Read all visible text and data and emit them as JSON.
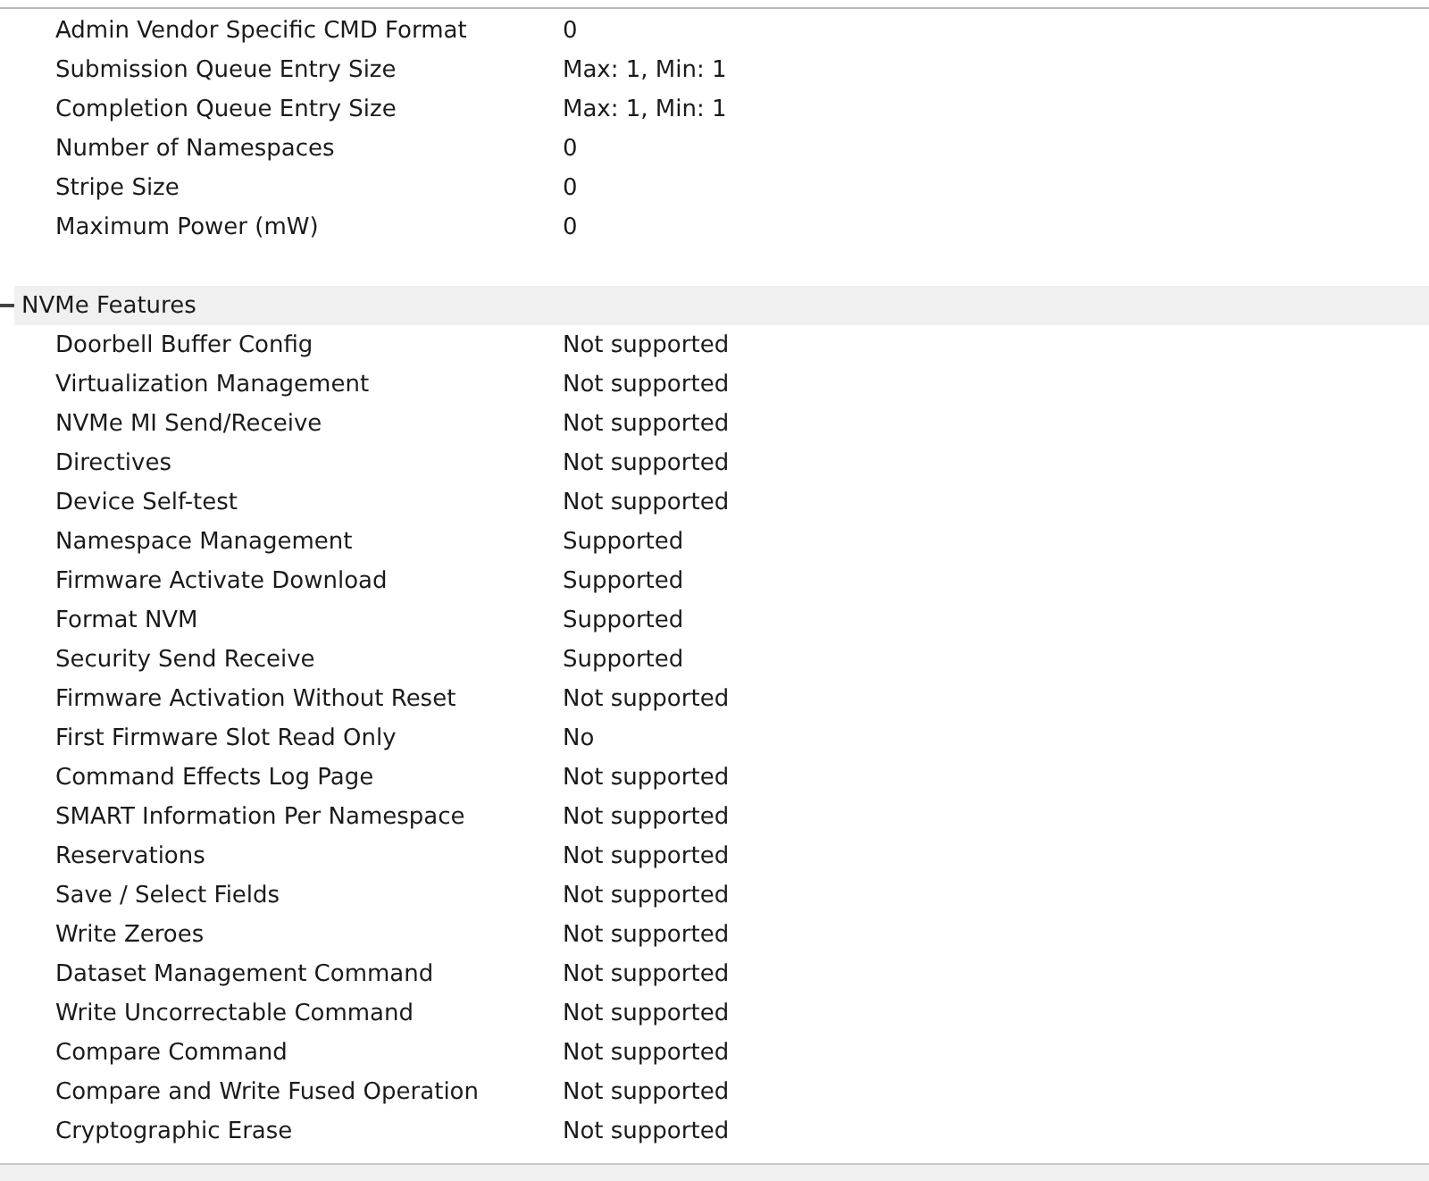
{
  "groups": [
    {
      "properties": [
        {
          "name": "Admin Vendor Specific CMD Format",
          "value": "0"
        },
        {
          "name": "Submission Queue Entry Size",
          "value": "Max: 1, Min: 1"
        },
        {
          "name": "Completion Queue Entry Size",
          "value": "Max: 1, Min: 1"
        },
        {
          "name": "Number of Namespaces",
          "value": "0"
        },
        {
          "name": "Stripe Size",
          "value": "0"
        },
        {
          "name": "Maximum Power (mW)",
          "value": "0"
        }
      ]
    },
    {
      "title": "NVMe Features",
      "expanded": true,
      "properties": [
        {
          "name": "Doorbell Buffer Config",
          "value": "Not supported"
        },
        {
          "name": "Virtualization Management",
          "value": "Not supported"
        },
        {
          "name": "NVMe MI Send/Receive",
          "value": "Not supported"
        },
        {
          "name": "Directives",
          "value": "Not supported"
        },
        {
          "name": "Device Self-test",
          "value": "Not supported"
        },
        {
          "name": "Namespace Management",
          "value": "Supported"
        },
        {
          "name": "Firmware Activate Download",
          "value": "Supported"
        },
        {
          "name": "Format NVM",
          "value": "Supported"
        },
        {
          "name": "Security Send Receive",
          "value": "Supported"
        },
        {
          "name": "Firmware Activation Without Reset",
          "value": "Not supported"
        },
        {
          "name": "First Firmware Slot Read Only",
          "value": "No"
        },
        {
          "name": "Command Effects Log Page",
          "value": "Not supported"
        },
        {
          "name": "SMART Information Per Namespace",
          "value": "Not supported"
        },
        {
          "name": "Reservations",
          "value": "Not supported"
        },
        {
          "name": "Save / Select Fields",
          "value": "Not supported"
        },
        {
          "name": "Write Zeroes",
          "value": "Not supported"
        },
        {
          "name": "Dataset Management Command",
          "value": "Not supported"
        },
        {
          "name": "Write Uncorrectable Command",
          "value": "Not supported"
        },
        {
          "name": "Compare Command",
          "value": "Not supported"
        },
        {
          "name": "Compare and Write Fused Operation",
          "value": "Not supported"
        },
        {
          "name": "Cryptographic Erase",
          "value": "Not supported"
        }
      ]
    }
  ]
}
